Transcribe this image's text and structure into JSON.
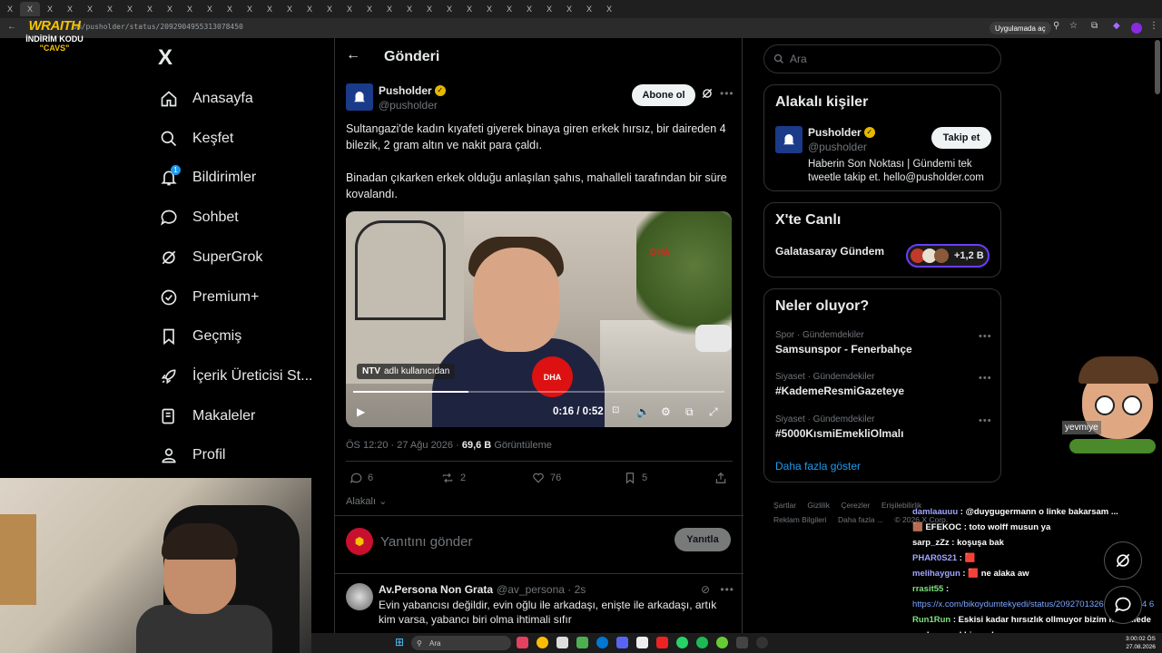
{
  "browser": {
    "url": "x.com/pusholder/status/2092904955313078450",
    "url_visible": "om/pusholder/status/2092904955313078450",
    "open_app_chip": "Uygulamada aç",
    "tab_glyph": "X",
    "tab_count": 31
  },
  "overlay_logo": {
    "line1": "WRAITH",
    "line2": "İNDİRİM KODU",
    "line3": "\"CAVS\""
  },
  "sidebar": {
    "logo": "X",
    "items": [
      {
        "label": "Anasayfa",
        "icon": "home-icon"
      },
      {
        "label": "Keşfet",
        "icon": "search-icon"
      },
      {
        "label": "Bildirimler",
        "icon": "bell-icon",
        "badge": "1"
      },
      {
        "label": "Sohbet",
        "icon": "chat-icon"
      },
      {
        "label": "SuperGrok",
        "icon": "grok-icon"
      },
      {
        "label": "Premium+",
        "icon": "verified-badge-icon"
      },
      {
        "label": "Geçmiş",
        "icon": "bookmark-icon"
      },
      {
        "label": "İçerik Üreticisi St...",
        "icon": "rocket-icon"
      },
      {
        "label": "Makaleler",
        "icon": "article-icon"
      },
      {
        "label": "Profil",
        "icon": "person-icon"
      }
    ]
  },
  "main": {
    "header_title": "Gönderi",
    "author": {
      "name": "Pusholder",
      "handle": "@pusholder",
      "subscribe_label": "Abone ol"
    },
    "text_p1": "Sultangazi'de kadın kıyafeti giyerek binaya giren erkek hırsız, bir daireden 4 bilezik, 2 gram altın ve nakit para çaldı.",
    "text_p2": "Binadan çıkarken erkek olduğu anlaşılan şahıs, mahalleli tarafından bir süre kovalandı.",
    "video": {
      "source_tag_bold": "NTV",
      "source_tag_rest": "adlı kullanıcıdan",
      "watermark": "DHA",
      "mic_label": "DHA",
      "time": "0:16 / 0:52",
      "progress": 0.31
    },
    "meta": {
      "time": "ÖS 12:20 · 27 Ağu 2026 ·",
      "views": "69,6 B",
      "views_label": "Görüntüleme"
    },
    "actions": {
      "replies": "6",
      "reposts": "2",
      "likes": "76",
      "bookmarks": "5"
    },
    "related_label": "Alakalı",
    "reply_placeholder": "Yanıtını gönder",
    "reply_button": "Yanıtla",
    "reply_tweet": {
      "name": "Av.Persona Non Grata",
      "handle": "@av_persona · 2s",
      "text": "Evin yabancısı değildir, evin oğlu ile arkadaşı,  enişte ile arkadaşı, artık kim varsa, yabancı biri olma ihtimali sıfır"
    }
  },
  "right": {
    "search_placeholder": "Ara",
    "related_people": {
      "title": "Alakalı kişiler",
      "name": "Pusholder",
      "handle": "@pusholder",
      "follow_label": "Takip et",
      "bio": "Haberin Son Noktası | Gündemi tek tweetle takip et. hello@pusholder.com"
    },
    "live": {
      "title": "X'te Canlı",
      "space": "Galatasaray Gündem",
      "count": "+1,2 B"
    },
    "trends": {
      "title": "Neler oluyor?",
      "items": [
        {
          "category": "Spor · Gündemdekiler",
          "title": "Samsunspor - Fenerbahçe"
        },
        {
          "category": "Siyaset · Gündemdekiler",
          "title": "#KademeResmiGazeteye"
        },
        {
          "category": "Siyaset · Gündemdekiler",
          "title": "#5000KısmiEmekliOlmalı"
        }
      ],
      "show_more": "Daha fazla göster"
    },
    "footer": [
      "Şartlar",
      "Gizlilik",
      "Çerezler",
      "Erişilebilirlik",
      "Reklam Bilgileri",
      "Daha fazla ...",
      "© 2026 X Corp."
    ]
  },
  "chat": [
    {
      "user": "damlaauuu",
      "msg": "@duygugermann o linke bakarsam ..."
    },
    {
      "user": "EFEKOC",
      "msg": "toto wolff musun ya"
    },
    {
      "user": "sarp_zZz",
      "msg": "koşuşa bak"
    },
    {
      "user": "PHAR0S21",
      "msg": "🟥"
    },
    {
      "user": "melihaygun",
      "msg": "🟥 ne alaka aw"
    },
    {
      "user": "rrasit55",
      "msg": "https://x.com/bikoydumtekyedi/status/2092701326919912814 6"
    },
    {
      "user": "Run1Run",
      "msg": "Eskisi kadar hırsızlık ollmuyor bizim mahallede acaba genel bir azalma mı var"
    }
  ],
  "mascot_label": "yevmiye",
  "taskbar": {
    "search": "Ara",
    "time": "3:00:02 ÖS",
    "date": "27.08.2026"
  }
}
